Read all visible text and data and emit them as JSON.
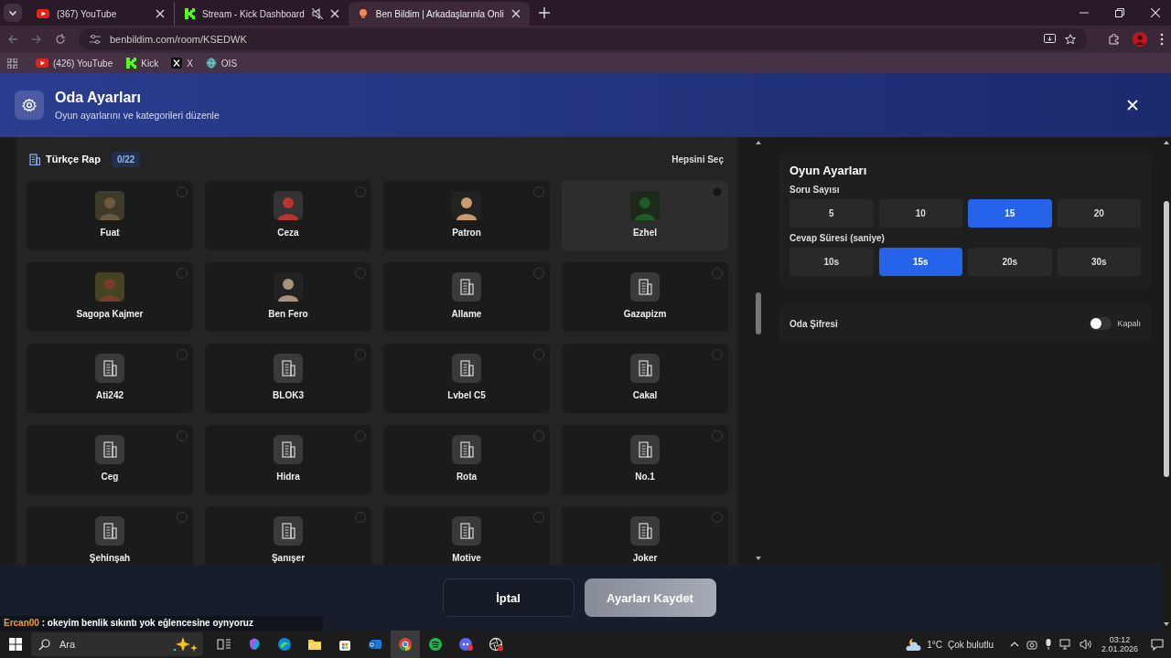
{
  "browser": {
    "tabs": [
      {
        "title": "(367) YouTube",
        "kind": "youtube",
        "muted": false,
        "selected": false
      },
      {
        "title": "Stream - Kick Dashboard",
        "kind": "kick",
        "muted": true,
        "selected": false
      },
      {
        "title": "Ben Bildim | Arkadaşlarınla Onli",
        "kind": "site",
        "muted": false,
        "selected": true
      }
    ],
    "address": "benbildim.com/room/KSEDWK",
    "bookmarks": [
      {
        "label": "(426) YouTube",
        "kind": "youtube"
      },
      {
        "label": "Kick",
        "kind": "kick"
      },
      {
        "label": "X",
        "kind": "x"
      },
      {
        "label": "OIS",
        "kind": "ois"
      }
    ]
  },
  "header": {
    "title": "Oda Ayarları",
    "subtitle": "Oyun ayarlarını ve kategorileri düzenle"
  },
  "category": {
    "name": "Türkçe Rap",
    "count": "0/22",
    "select_all": "Hepsini Seç",
    "items": [
      {
        "name": "Fuat",
        "kind": "avatar",
        "selected": false,
        "hovered": false
      },
      {
        "name": "Ceza",
        "kind": "avatar",
        "selected": false,
        "hovered": false
      },
      {
        "name": "Patron",
        "kind": "avatar",
        "selected": false,
        "hovered": false
      },
      {
        "name": "Ezhel",
        "kind": "avatar",
        "selected": false,
        "hovered": true
      },
      {
        "name": "Sagopa Kajmer",
        "kind": "avatar",
        "selected": false,
        "hovered": false
      },
      {
        "name": "Ben Fero",
        "kind": "avatar",
        "selected": false,
        "hovered": false
      },
      {
        "name": "Allame",
        "kind": "icon",
        "selected": false,
        "hovered": false
      },
      {
        "name": "Gazapizm",
        "kind": "icon",
        "selected": false,
        "hovered": false
      },
      {
        "name": "Ati242",
        "kind": "icon",
        "selected": false,
        "hovered": false
      },
      {
        "name": "BLOK3",
        "kind": "icon",
        "selected": false,
        "hovered": false
      },
      {
        "name": "Lvbel C5",
        "kind": "icon",
        "selected": false,
        "hovered": false
      },
      {
        "name": "Cakal",
        "kind": "icon",
        "selected": false,
        "hovered": false
      },
      {
        "name": "Ceg",
        "kind": "icon",
        "selected": false,
        "hovered": false
      },
      {
        "name": "Hidra",
        "kind": "icon",
        "selected": false,
        "hovered": false
      },
      {
        "name": "Rota",
        "kind": "icon",
        "selected": false,
        "hovered": false
      },
      {
        "name": "No.1",
        "kind": "icon",
        "selected": false,
        "hovered": false
      },
      {
        "name": "Şehinşah",
        "kind": "icon",
        "selected": false,
        "hovered": false
      },
      {
        "name": "Şanışer",
        "kind": "icon",
        "selected": false,
        "hovered": false
      },
      {
        "name": "Motive",
        "kind": "icon",
        "selected": false,
        "hovered": false
      },
      {
        "name": "Joker",
        "kind": "icon",
        "selected": false,
        "hovered": false
      }
    ]
  },
  "game_settings": {
    "title": "Oyun Ayarları",
    "groups": [
      {
        "label": "Soru Sayısı",
        "options": [
          {
            "label": "5",
            "selected": false
          },
          {
            "label": "10",
            "selected": false
          },
          {
            "label": "15",
            "selected": true
          },
          {
            "label": "20",
            "selected": false
          }
        ]
      },
      {
        "label": "Cevap Süresi (saniye)",
        "options": [
          {
            "label": "10s",
            "selected": false
          },
          {
            "label": "15s",
            "selected": true
          },
          {
            "label": "20s",
            "selected": false
          },
          {
            "label": "30s",
            "selected": false
          }
        ]
      }
    ]
  },
  "password": {
    "label": "Oda Şifresi",
    "on": false,
    "state_label": "Kapalı"
  },
  "footer": {
    "buttons": [
      {
        "label": "İptal",
        "kind": "secondary"
      },
      {
        "label": "Ayarları Kaydet",
        "kind": "primary"
      }
    ]
  },
  "chat": {
    "user": "Ercan00",
    "message": ": okeyim benlik sıkıntı yok eğlencesine oynyoruz"
  },
  "taskbar": {
    "search_placeholder": "Ara",
    "weather": {
      "temperature": "1°C",
      "condition": "Çok bulutlu"
    },
    "time": "03:12",
    "date": "2.01.2026"
  }
}
